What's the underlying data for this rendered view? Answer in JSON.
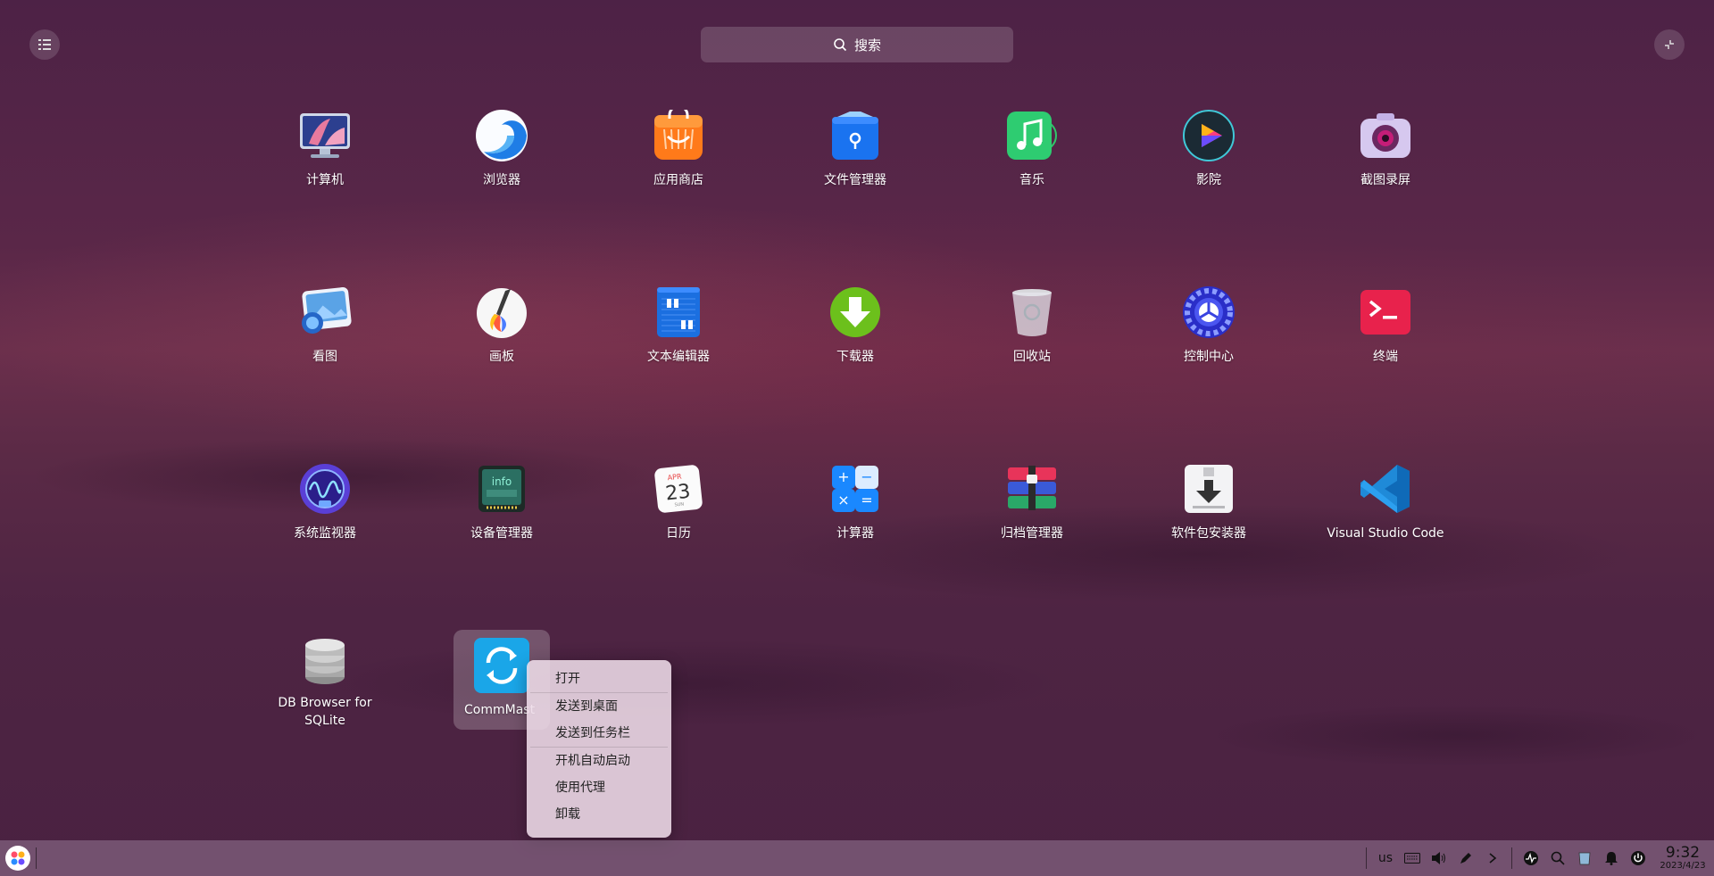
{
  "search": {
    "placeholder": "搜索"
  },
  "apps": [
    {
      "label": "计算机",
      "icon": "computer-icon"
    },
    {
      "label": "浏览器",
      "icon": "browser-icon"
    },
    {
      "label": "应用商店",
      "icon": "app-store-icon"
    },
    {
      "label": "文件管理器",
      "icon": "file-manager-icon"
    },
    {
      "label": "音乐",
      "icon": "music-icon"
    },
    {
      "label": "影院",
      "icon": "movie-icon"
    },
    {
      "label": "截图录屏",
      "icon": "screenshot-icon"
    },
    {
      "label": "看图",
      "icon": "image-viewer-icon"
    },
    {
      "label": "画板",
      "icon": "draw-icon"
    },
    {
      "label": "文本编辑器",
      "icon": "text-editor-icon"
    },
    {
      "label": "下载器",
      "icon": "downloader-icon"
    },
    {
      "label": "回收站",
      "icon": "trash-icon"
    },
    {
      "label": "控制中心",
      "icon": "control-center-icon"
    },
    {
      "label": "终端",
      "icon": "terminal-icon"
    },
    {
      "label": "系统监视器",
      "icon": "system-monitor-icon"
    },
    {
      "label": "设备管理器",
      "icon": "device-manager-icon"
    },
    {
      "label": "日历",
      "icon": "calendar-icon",
      "month": "APR",
      "day": "23",
      "weekday": "SUN"
    },
    {
      "label": "计算器",
      "icon": "calculator-icon"
    },
    {
      "label": "归档管理器",
      "icon": "archive-manager-icon"
    },
    {
      "label": "软件包安装器",
      "icon": "package-installer-icon"
    },
    {
      "label": "Visual Studio Code",
      "icon": "vscode-icon"
    },
    {
      "label": "DB Browser for SQLite",
      "icon": "database-icon"
    },
    {
      "label": "CommMast",
      "icon": "sync-icon"
    }
  ],
  "device_icon_text": "info",
  "calc_symbols": [
    "+",
    "−",
    "×",
    "="
  ],
  "context_menu": {
    "items": [
      "打开",
      "发送到桌面",
      "发送到任务栏",
      "开机自动启动",
      "使用代理",
      "卸载"
    ]
  },
  "taskbar": {
    "keyboard_layout": "us",
    "time": "9:32",
    "date": "2023/4/23",
    "tray_icons": [
      "keyboard-icon",
      "volume-icon",
      "pen-icon",
      "chevron-right-icon",
      "system-monitor-icon",
      "search-icon",
      "trash-icon",
      "bell-icon",
      "power-icon"
    ]
  }
}
